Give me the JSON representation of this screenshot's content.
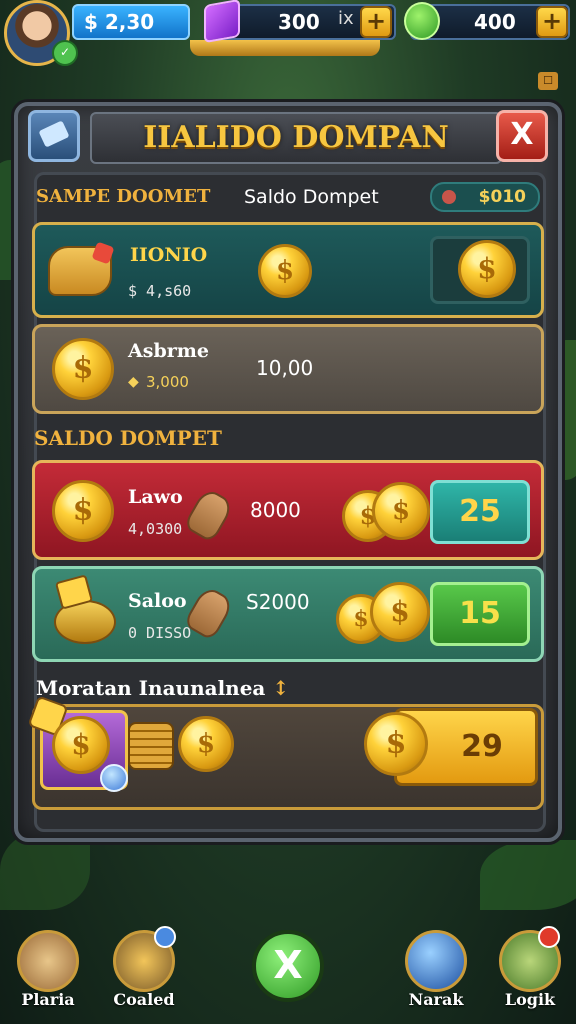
{
  "top_bar": {
    "cash": "$ 2,30",
    "gems": "300",
    "gems_multiplier": "ix",
    "leaves": "400",
    "plus": "+"
  },
  "panel": {
    "title": "IIALIDO DOMPAN",
    "close_symbol": "X"
  },
  "header": {
    "left": "SAMPE DOOMET",
    "middle": "Saldo Dompet",
    "balance": "$010"
  },
  "wallet_rows": [
    {
      "name": "IIONIO",
      "sub": "$ 4,s60",
      "coin_symbol": "$"
    },
    {
      "name": "Asbrme",
      "sub": "3,000",
      "value": "10,00",
      "coin_symbol": "$"
    }
  ],
  "section_two": {
    "title": "SALDO DOMPET",
    "rows": [
      {
        "name": "Lawo",
        "sub": "4,0300",
        "value": "8000",
        "reward": "25"
      },
      {
        "name": "Saloo",
        "sub": "0 DISSO",
        "value": "S2000",
        "reward": "15"
      }
    ]
  },
  "section_three": {
    "title": "Moratan Inaunalnea",
    "arrow": "↕",
    "reward": "29"
  },
  "bottom_nav": [
    {
      "label": "Plaria"
    },
    {
      "label": "Coaled"
    },
    {
      "label": ""
    },
    {
      "label": "Narak"
    },
    {
      "label": "Logik"
    }
  ],
  "play_symbol": "X",
  "colors": {
    "title_gold": "#f7c640",
    "teal_card": "#1e5a5a",
    "red_card": "#c42b38",
    "green_card": "#3c8a74",
    "reward_gold": "#ffd54a"
  },
  "icons": [
    "avatar",
    "gem-icon",
    "leaf-icon",
    "plus-icon",
    "notification-icon",
    "hammer-icon",
    "close-icon",
    "coin-icon",
    "ticket-icon",
    "bag-icon",
    "coin-stack-icon",
    "globe-icon",
    "play-icon"
  ]
}
